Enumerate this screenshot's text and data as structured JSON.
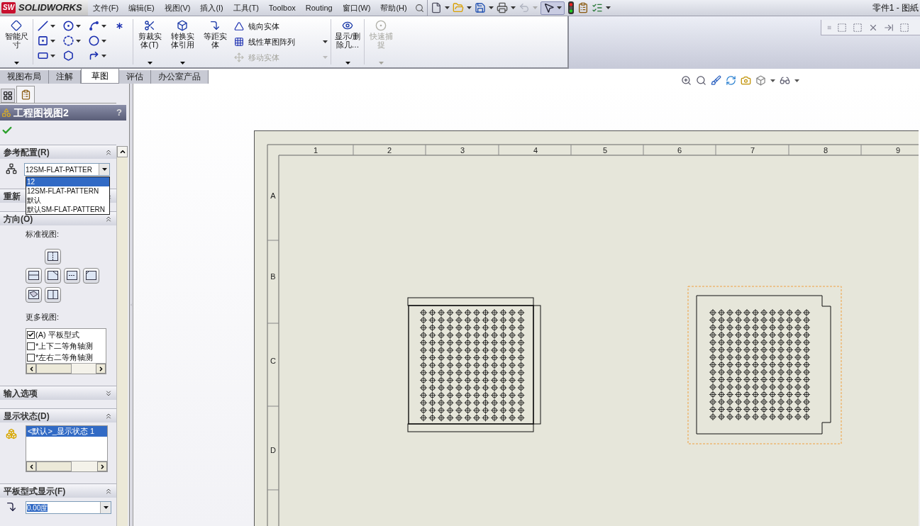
{
  "app": {
    "logo_badge": "SW",
    "logo": "SOLIDWORKS",
    "title": "零件1 - 图紙"
  },
  "menu": [
    "文件(F)",
    "编辑(E)",
    "视图(V)",
    "插入(I)",
    "工具(T)",
    "Toolbox",
    "Routing",
    "窗口(W)",
    "帮助(H)"
  ],
  "quick_toolbar": {
    "undo_disabled": true,
    "select_selected": true
  },
  "ribbon": {
    "large_tools": [
      {
        "label": "智能尺寸",
        "disabled": false,
        "menu": true
      },
      {
        "label": "剪裁实体(T)",
        "disabled": false,
        "menu": true
      },
      {
        "label": "转换实体引用",
        "disabled": false,
        "menu": true
      },
      {
        "label": "等距实体",
        "disabled": false,
        "menu": false
      },
      {
        "label": "显示/删除几…",
        "disabled": false,
        "menu": true
      },
      {
        "label": "快速捕捉",
        "disabled": true,
        "menu": true
      }
    ],
    "small_tools": [
      {
        "label": "镜向实体",
        "disabled": false
      },
      {
        "label": "线性草图阵列",
        "disabled": false
      },
      {
        "label": "移动实体",
        "disabled": true
      }
    ]
  },
  "tabs": [
    {
      "label": "视图布局",
      "selected": false
    },
    {
      "label": "注解",
      "selected": false
    },
    {
      "label": "草图",
      "selected": true
    },
    {
      "label": "评估",
      "selected": false
    },
    {
      "label": "办公室产品",
      "selected": false
    }
  ],
  "property_manager": {
    "title": "工程图视图2",
    "help": "?",
    "reference_config": {
      "heading": "参考配置(R)",
      "expanded": true,
      "value": "12SM-FLAT-PATTER",
      "options": [
        {
          "label": "12",
          "selected": true
        },
        {
          "label": "12SM-FLAT-PATTERN",
          "selected": false
        },
        {
          "label": "默认",
          "selected": false
        },
        {
          "label": "默认SM-FLAT-PATTERN",
          "selected": false
        }
      ]
    },
    "rename_heading": "重新",
    "orientation": {
      "heading": "方向(O)",
      "expanded": true,
      "standard_label": "标准视图:",
      "more_label": "更多视图:",
      "more_views": [
        {
          "label": "(A) 平板型式",
          "checked": true
        },
        {
          "label": "*上下二等角轴测",
          "checked": false
        },
        {
          "label": "*左右二等角轴测",
          "checked": false
        }
      ]
    },
    "import_options": {
      "heading": "输入选项",
      "expanded": false
    },
    "display_state": {
      "heading": "显示状态(D)",
      "expanded": true,
      "items": [
        {
          "label": "<默认>_显示状态 1",
          "selected": true
        }
      ]
    },
    "flat_pattern_display": {
      "heading": "平板型式显示(F)",
      "expanded": true,
      "value": "0.00度"
    }
  },
  "sheet": {
    "columns": [
      "1",
      "2",
      "3",
      "4",
      "5",
      "6",
      "7",
      "8",
      "9"
    ],
    "rows": [
      "A",
      "B",
      "C",
      "D"
    ],
    "views": [
      {
        "selected": false
      },
      {
        "selected": true
      }
    ]
  }
}
